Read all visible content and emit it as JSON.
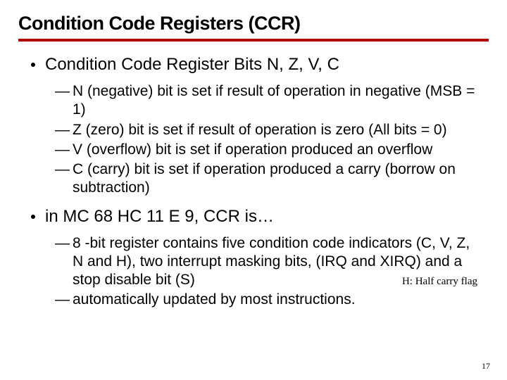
{
  "title": "Condition Code Registers (CCR)",
  "bullets": [
    {
      "text": "Condition Code Register Bits N, Z, V, C",
      "subs": [
        "N (negative) bit is set if result of operation in negative (MSB = 1)",
        "Z (zero) bit is set if result of operation is zero (All bits = 0)",
        "V (overflow) bit is set if operation produced an overflow",
        "C (carry) bit is set if operation produced a carry (borrow on subtraction)"
      ]
    },
    {
      "text": " in MC 68 HC 11 E 9, CCR is…",
      "subs": [
        "8 -bit register contains five condition code indicators (C, V, Z, N and H), two interrupt masking bits, (IRQ and XIRQ) and a stop disable bit (S)",
        " automatically updated by most instructions."
      ]
    }
  ],
  "note": "H: Half carry flag",
  "page_number": "17",
  "dash_glyph": "—"
}
